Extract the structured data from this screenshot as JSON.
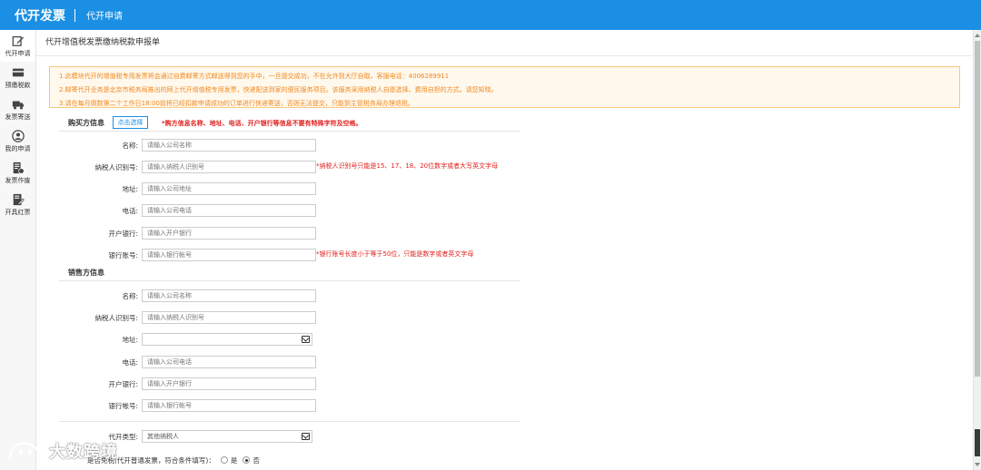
{
  "topbar": {
    "brand": "代开发票",
    "subtitle": "代开申请"
  },
  "sidebar": {
    "items": [
      {
        "label": "代开申请",
        "icon": "edit-icon"
      },
      {
        "label": "预缴税款",
        "icon": "card-icon"
      },
      {
        "label": "发票寄送",
        "icon": "truck-icon"
      },
      {
        "label": "我的申请",
        "icon": "user-icon"
      },
      {
        "label": "发票作废",
        "icon": "invoice-void-icon"
      },
      {
        "label": "开具红票",
        "icon": "red-invoice-icon"
      }
    ]
  },
  "page": {
    "title": "代开增值税发票缴纳税款申报单"
  },
  "notice": {
    "lines": [
      "1.此模块代开的增值税专用发票将会通过自费邮寄方式邮送得到您的手中，一旦提交成功，不在允许到大厅自取。客服电话：4006289911",
      "2.邮寄代开业务是北京市税务局推出的网上代开增值税专用发票，快递配送到家的便民服务项目。该服务采用纳税人自愿选择、费用自担的方式。请您知晓。",
      "3.请在每月倒数第二个工作日18:00前将已经扣款申请成功的订单进行快递寄送，否则无法提交，只能到主管税务局办理退税。"
    ]
  },
  "buyer": {
    "heading": "购买方信息",
    "pick_button": "点击选择",
    "warning": "*购方信息名称、地址、电话、开户银行等信息不要有特殊字符及空格。",
    "fields": [
      {
        "label": "名称:",
        "placeholder": "请输入公司名称",
        "hint": ""
      },
      {
        "label": "纳税人识别号:",
        "placeholder": "请输入纳税人识别号",
        "hint": "*纳税人识别号只能是15、17、18、20位数字或者大写英文字母"
      },
      {
        "label": "地址:",
        "placeholder": "请输入公司地址",
        "hint": ""
      },
      {
        "label": "电话:",
        "placeholder": "请输入公司电话",
        "hint": ""
      },
      {
        "label": "开户银行:",
        "placeholder": "请输入开户银行",
        "hint": ""
      },
      {
        "label": "银行账号:",
        "placeholder": "请输入银行帐号",
        "hint": "*银行账号长度小于等于50位，只能是数字或者英文字母"
      }
    ]
  },
  "seller": {
    "heading": "销售方信息",
    "fields": [
      {
        "label": "名称:",
        "placeholder": "请输入公司名称"
      },
      {
        "label": "纳税人识别号:",
        "placeholder": "请输入纳税人识别号"
      },
      {
        "label": "地址:",
        "value": ""
      },
      {
        "label": "电话:",
        "placeholder": "请输入公司电话"
      },
      {
        "label": "开户银行:",
        "placeholder": "请输入开户银行"
      },
      {
        "label": "银行帐号:",
        "placeholder": "请输入银行帐号"
      }
    ]
  },
  "agent_type": {
    "label": "代开类型:",
    "value": "其他纳税人"
  },
  "tax_exempt": {
    "label": "是否免税(代开普通发票，符合条件填写)：",
    "options": [
      "是",
      "否"
    ],
    "selected": "否"
  },
  "watermark": {
    "text": "大数跨境"
  },
  "colors": {
    "brand": "#1a8fe3",
    "warning": "#e0201d",
    "notice_text": "#f08a24",
    "notice_bg": "#fff8ec"
  }
}
